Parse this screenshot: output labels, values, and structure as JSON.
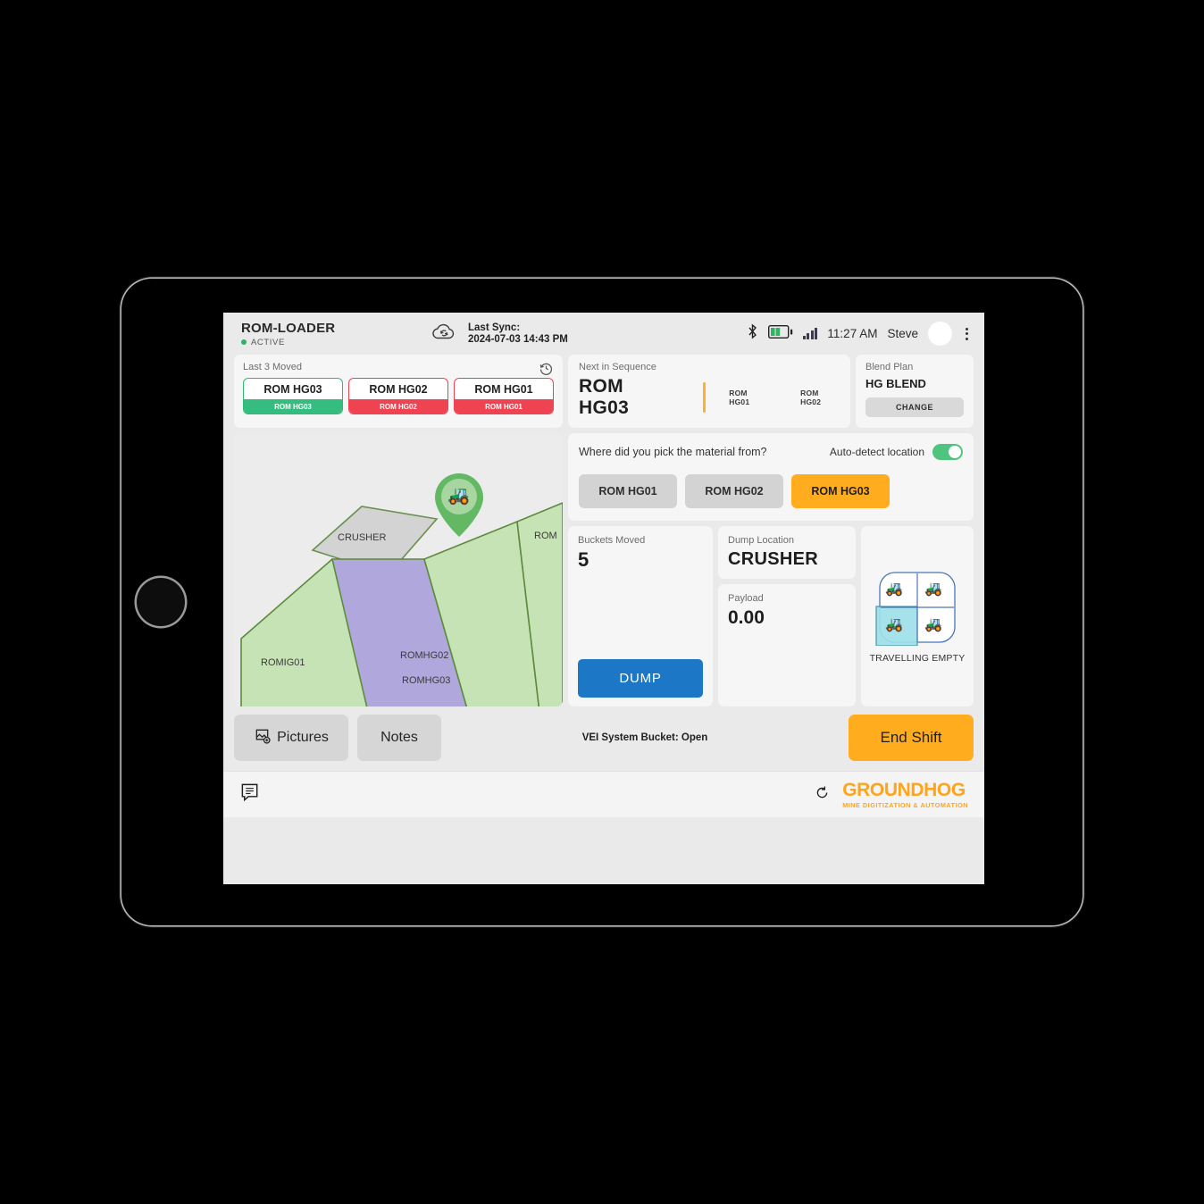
{
  "header": {
    "app_title": "ROM-LOADER",
    "status_label": "ACTIVE",
    "sync_title": "Last Sync:",
    "sync_time": "2024-07-03 14:43 PM",
    "clock": "11:27 AM",
    "user": "Steve",
    "icons": {
      "sync": "cloud-sync-icon",
      "bluetooth": "bluetooth-icon",
      "battery": "battery-icon",
      "signal": "signal-bars-icon",
      "avatar": "avatar",
      "menu": "kebab-menu-icon"
    }
  },
  "last_moved": {
    "label": "Last 3 Moved",
    "history_icon": "history-icon",
    "chips": [
      {
        "top": "ROM HG03",
        "bottom": "ROM HG03",
        "state": "green"
      },
      {
        "top": "ROM HG02",
        "bottom": "ROM HG02",
        "state": "red"
      },
      {
        "top": "ROM HG01",
        "bottom": "ROM HG01",
        "state": "red"
      }
    ]
  },
  "next_in_sequence": {
    "label": "Next in Sequence",
    "current": "ROM HG03",
    "upcoming": [
      "ROM HG01",
      "ROM HG02"
    ]
  },
  "blend_plan": {
    "label": "Blend Plan",
    "value": "HG BLEND",
    "change_label": "CHANGE"
  },
  "map": {
    "crusher_label": "CRUSHER",
    "zones": [
      "ROMIG01",
      "ROMHG03",
      "ROMHG02",
      "ROM"
    ],
    "marker_icon": "loader-map-pin-icon"
  },
  "pick_from": {
    "question": "Where did you pick the material from?",
    "auto_detect_label": "Auto-detect location",
    "auto_detect_on": true,
    "options": [
      {
        "label": "ROM HG01",
        "selected": false
      },
      {
        "label": "ROM HG02",
        "selected": false
      },
      {
        "label": "ROM HG03",
        "selected": true
      }
    ]
  },
  "stats": {
    "buckets_label": "Buckets Moved",
    "buckets_value": "5",
    "dump_button": "DUMP",
    "dump_location_label": "Dump Location",
    "dump_location_value": "CRUSHER",
    "payload_label": "Payload",
    "payload_value": "0.00"
  },
  "state_widget": {
    "caption": "TRAVELLING EMPTY",
    "quadrants": [
      {
        "name": "loading",
        "active": false
      },
      {
        "name": "travelling-loaded",
        "active": false
      },
      {
        "name": "travelling-empty",
        "active": true
      },
      {
        "name": "dumping",
        "active": false
      }
    ]
  },
  "action_bar": {
    "pictures_label": "Pictures",
    "notes_label": "Notes",
    "vei_status": "VEI System Bucket: Open",
    "end_shift_label": "End Shift"
  },
  "footer": {
    "notes_icon": "message-note-icon",
    "refresh_icon": "refresh-icon",
    "logo_main": "GROUNDHOG",
    "logo_sub": "MINE DIGITIZATION & AUTOMATION"
  },
  "colors": {
    "accent_orange": "#ffad1f",
    "green": "#34bd7e",
    "red": "#ef4352",
    "blue": "#1c77c6"
  }
}
